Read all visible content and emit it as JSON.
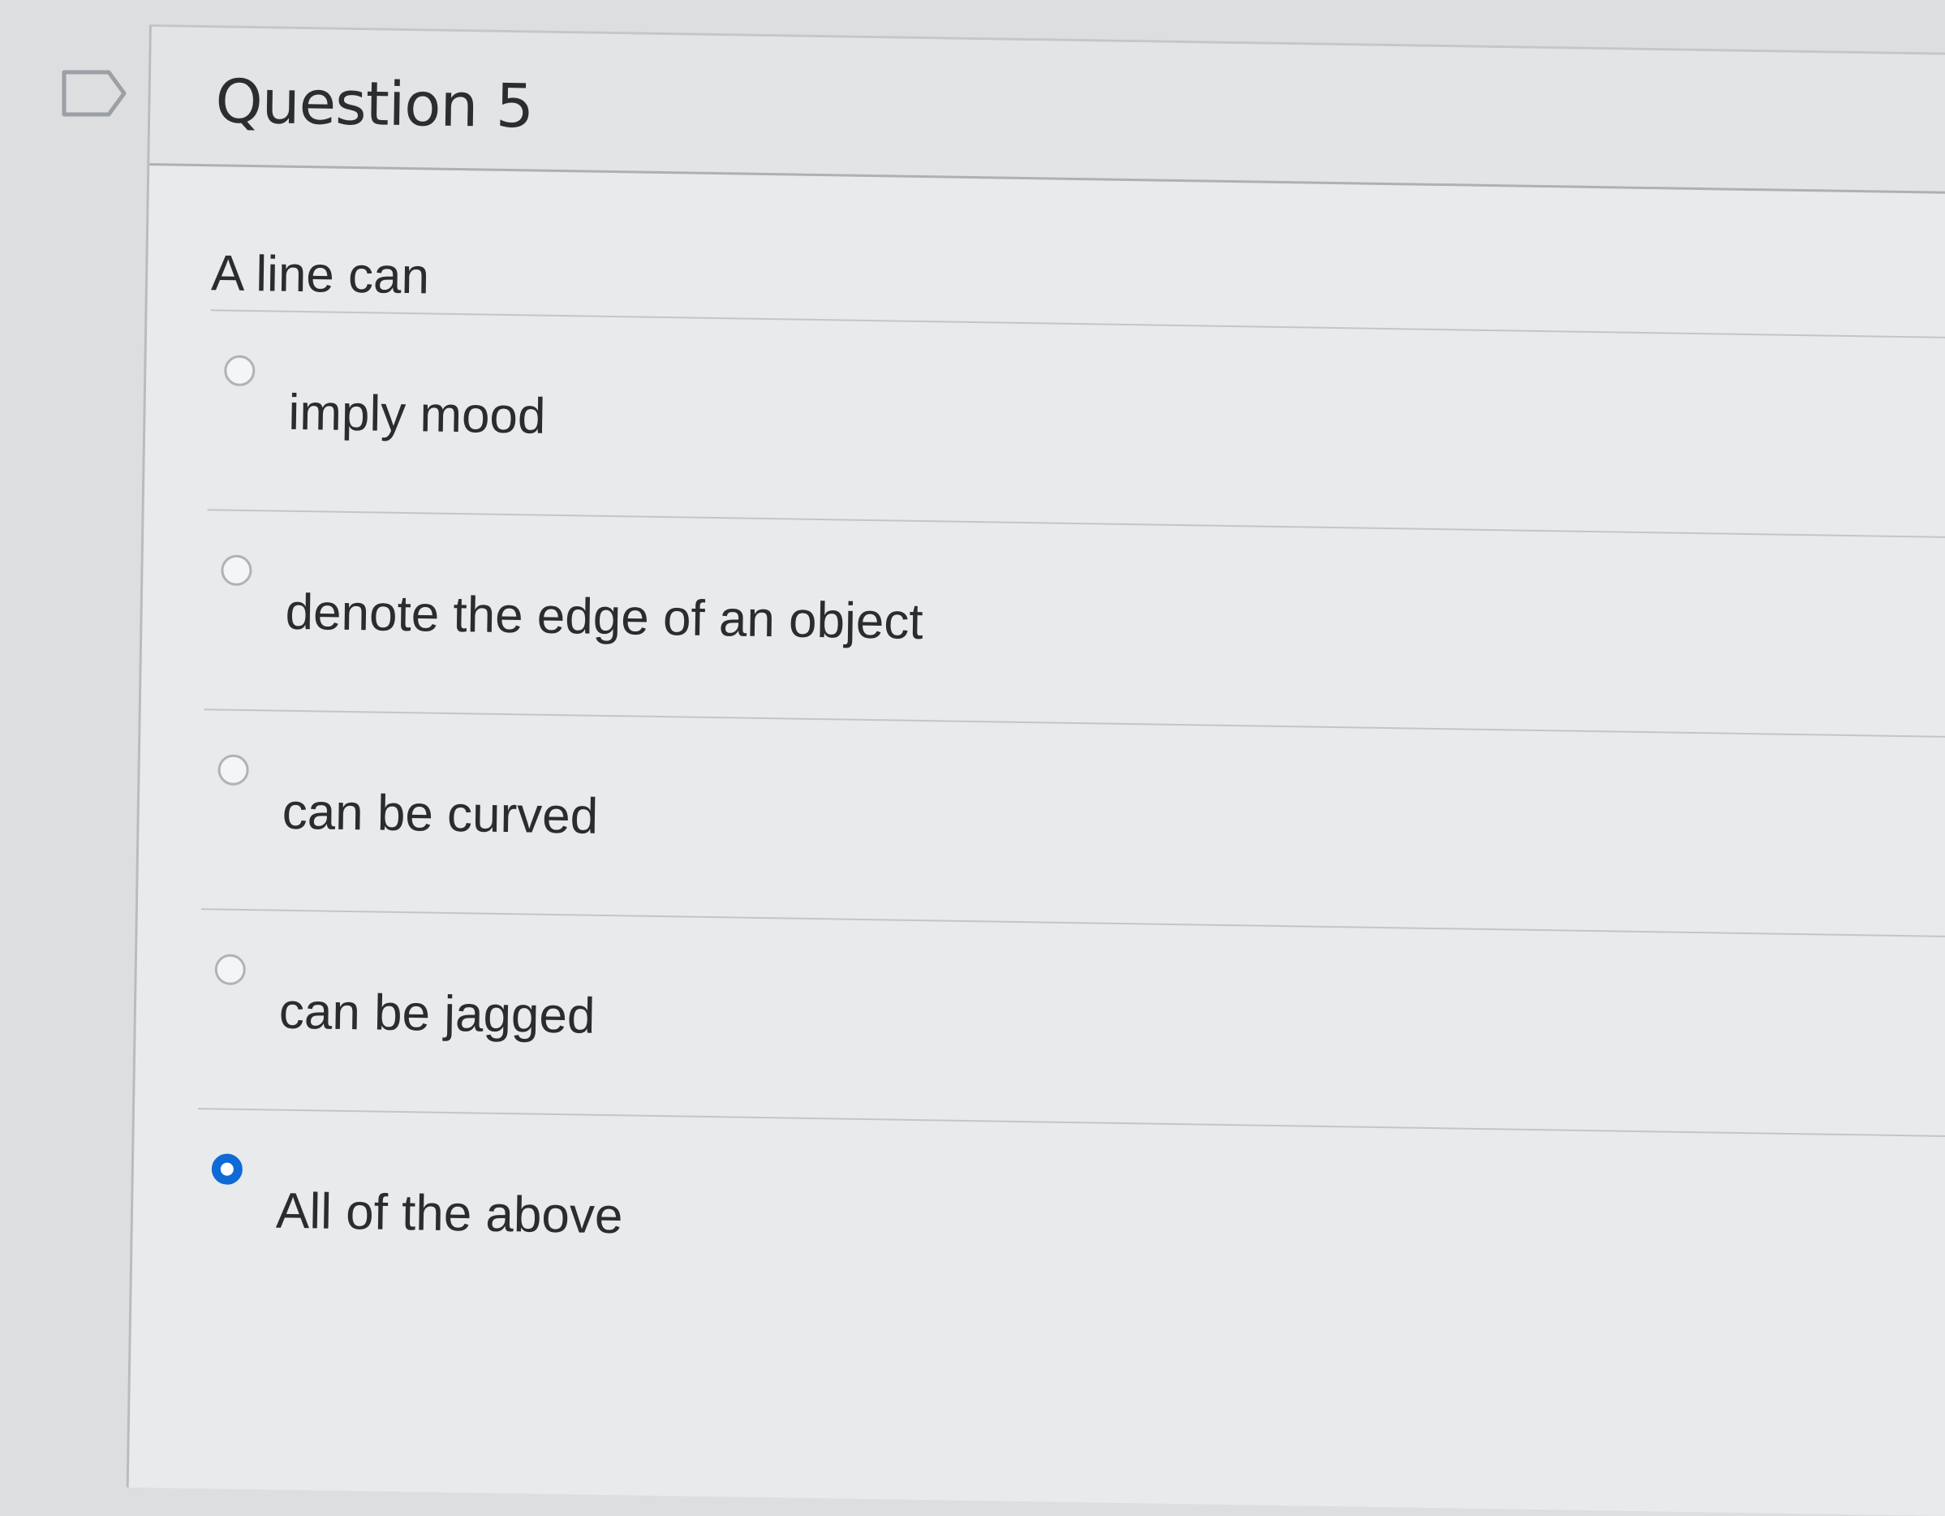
{
  "question": {
    "title": "Question 5",
    "prompt": "A line can",
    "flag_icon": "flag-outline-icon"
  },
  "answers": [
    {
      "label": "imply mood",
      "selected": false
    },
    {
      "label": "denote the edge of an object",
      "selected": false
    },
    {
      "label": "can be curved",
      "selected": false
    },
    {
      "label": "can be jagged",
      "selected": false
    },
    {
      "label": "All of the above",
      "selected": true
    }
  ],
  "colors": {
    "accent": "#0f6ad8",
    "text": "#2a2d30",
    "divider": "#c3c6c8"
  }
}
